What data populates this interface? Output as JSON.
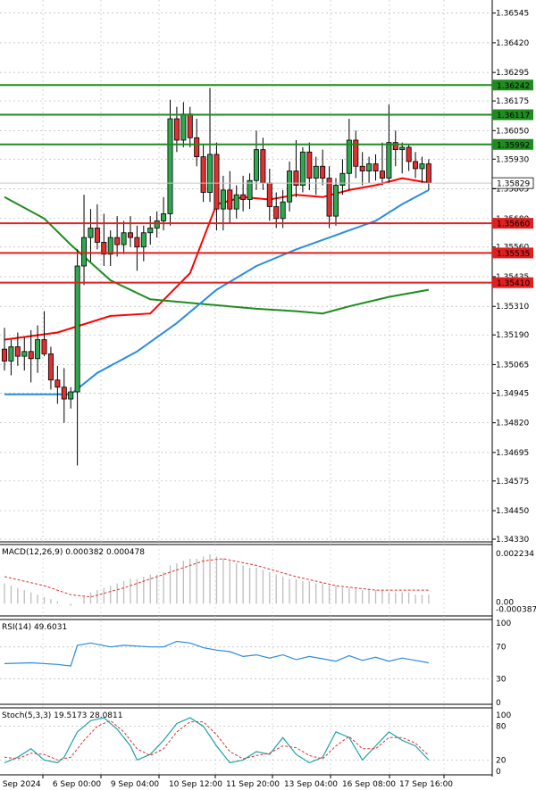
{
  "chart_data": {
    "type": "candlestick",
    "price_axis": {
      "ticks": [
        "1.36545",
        "1.36420",
        "1.36295",
        "1.36175",
        "1.36050",
        "1.35930",
        "1.35805",
        "1.35680",
        "1.35560",
        "1.35435",
        "1.35310",
        "1.35190",
        "1.35065",
        "1.34945",
        "1.34820",
        "1.34695",
        "1.34575",
        "1.34450",
        "1.34330"
      ],
      "range": [
        1.3433,
        1.366
      ]
    },
    "time_axis": {
      "labels": [
        "5 Sep 2024",
        "6 Sep 00:00",
        "9 Sep 04:00",
        "10 Sep 12:00",
        "11 Sep 20:00",
        "13 Sep 04:00",
        "16 Sep 08:00",
        "17 Sep 16:00"
      ]
    },
    "levels": [
      {
        "value": "1.36242",
        "color": "#1e8c1e"
      },
      {
        "value": "1.36117",
        "color": "#1e8c1e"
      },
      {
        "value": "1.35992",
        "color": "#1e8c1e"
      },
      {
        "value": "1.35660",
        "color": "#e02020"
      },
      {
        "value": "1.35535",
        "color": "#e02020"
      },
      {
        "value": "1.35410",
        "color": "#e02020"
      }
    ],
    "current_price": {
      "value": "1.35829",
      "color": "#c8c8c8"
    },
    "candles": [
      {
        "o": 1.3513,
        "h": 1.3522,
        "l": 1.3504,
        "c": 1.3508
      },
      {
        "o": 1.3508,
        "h": 1.3517,
        "l": 1.3502,
        "c": 1.3514
      },
      {
        "o": 1.3514,
        "h": 1.352,
        "l": 1.3506,
        "c": 1.351
      },
      {
        "o": 1.351,
        "h": 1.3518,
        "l": 1.3504,
        "c": 1.3512
      },
      {
        "o": 1.3512,
        "h": 1.3521,
        "l": 1.3499,
        "c": 1.3509
      },
      {
        "o": 1.3509,
        "h": 1.3523,
        "l": 1.3503,
        "c": 1.3517
      },
      {
        "o": 1.3517,
        "h": 1.3529,
        "l": 1.351,
        "c": 1.3511
      },
      {
        "o": 1.3511,
        "h": 1.3514,
        "l": 1.3496,
        "c": 1.35
      },
      {
        "o": 1.35,
        "h": 1.3506,
        "l": 1.349,
        "c": 1.3497
      },
      {
        "o": 1.3497,
        "h": 1.3505,
        "l": 1.3482,
        "c": 1.3492
      },
      {
        "o": 1.3492,
        "h": 1.3497,
        "l": 1.3488,
        "c": 1.3495
      },
      {
        "o": 1.3495,
        "h": 1.3555,
        "l": 1.3464,
        "c": 1.3548
      },
      {
        "o": 1.3548,
        "h": 1.3578,
        "l": 1.354,
        "c": 1.356
      },
      {
        "o": 1.356,
        "h": 1.3572,
        "l": 1.355,
        "c": 1.3564
      },
      {
        "o": 1.3564,
        "h": 1.3574,
        "l": 1.3555,
        "c": 1.3558
      },
      {
        "o": 1.3558,
        "h": 1.357,
        "l": 1.3548,
        "c": 1.3553
      },
      {
        "o": 1.3553,
        "h": 1.3563,
        "l": 1.3548,
        "c": 1.356
      },
      {
        "o": 1.356,
        "h": 1.3569,
        "l": 1.3552,
        "c": 1.3557
      },
      {
        "o": 1.3557,
        "h": 1.3567,
        "l": 1.3553,
        "c": 1.3562
      },
      {
        "o": 1.3562,
        "h": 1.3569,
        "l": 1.3556,
        "c": 1.356
      },
      {
        "o": 1.356,
        "h": 1.3565,
        "l": 1.3546,
        "c": 1.3556
      },
      {
        "o": 1.3556,
        "h": 1.3565,
        "l": 1.355,
        "c": 1.3562
      },
      {
        "o": 1.3562,
        "h": 1.3569,
        "l": 1.3557,
        "c": 1.3564
      },
      {
        "o": 1.3564,
        "h": 1.3571,
        "l": 1.356,
        "c": 1.3567
      },
      {
        "o": 1.3567,
        "h": 1.3577,
        "l": 1.3563,
        "c": 1.357
      },
      {
        "o": 1.357,
        "h": 1.3618,
        "l": 1.3565,
        "c": 1.361
      },
      {
        "o": 1.361,
        "h": 1.3615,
        "l": 1.3596,
        "c": 1.3601
      },
      {
        "o": 1.3601,
        "h": 1.3617,
        "l": 1.3598,
        "c": 1.3612
      },
      {
        "o": 1.3612,
        "h": 1.3615,
        "l": 1.3598,
        "c": 1.3602
      },
      {
        "o": 1.3602,
        "h": 1.361,
        "l": 1.359,
        "c": 1.3594
      },
      {
        "o": 1.3594,
        "h": 1.3599,
        "l": 1.3575,
        "c": 1.3579
      },
      {
        "o": 1.3579,
        "h": 1.3623,
        "l": 1.3575,
        "c": 1.3595
      },
      {
        "o": 1.3595,
        "h": 1.36,
        "l": 1.3563,
        "c": 1.3572
      },
      {
        "o": 1.3572,
        "h": 1.3586,
        "l": 1.3563,
        "c": 1.358
      },
      {
        "o": 1.358,
        "h": 1.3588,
        "l": 1.3566,
        "c": 1.3572
      },
      {
        "o": 1.3572,
        "h": 1.3582,
        "l": 1.3568,
        "c": 1.3578
      },
      {
        "o": 1.3578,
        "h": 1.3586,
        "l": 1.3571,
        "c": 1.3576
      },
      {
        "o": 1.3576,
        "h": 1.3587,
        "l": 1.3572,
        "c": 1.3584
      },
      {
        "o": 1.3584,
        "h": 1.3605,
        "l": 1.358,
        "c": 1.3597
      },
      {
        "o": 1.3597,
        "h": 1.3602,
        "l": 1.358,
        "c": 1.3583
      },
      {
        "o": 1.3583,
        "h": 1.3589,
        "l": 1.3567,
        "c": 1.3573
      },
      {
        "o": 1.3573,
        "h": 1.3579,
        "l": 1.3564,
        "c": 1.3568
      },
      {
        "o": 1.3568,
        "h": 1.358,
        "l": 1.3564,
        "c": 1.3575
      },
      {
        "o": 1.3575,
        "h": 1.3592,
        "l": 1.3571,
        "c": 1.3588
      },
      {
        "o": 1.3588,
        "h": 1.3601,
        "l": 1.3577,
        "c": 1.3582
      },
      {
        "o": 1.3582,
        "h": 1.3598,
        "l": 1.3579,
        "c": 1.3596
      },
      {
        "o": 1.3596,
        "h": 1.36,
        "l": 1.358,
        "c": 1.3585
      },
      {
        "o": 1.3585,
        "h": 1.3594,
        "l": 1.3578,
        "c": 1.359
      },
      {
        "o": 1.359,
        "h": 1.3597,
        "l": 1.3582,
        "c": 1.3585
      },
      {
        "o": 1.3585,
        "h": 1.359,
        "l": 1.3564,
        "c": 1.3569
      },
      {
        "o": 1.3569,
        "h": 1.3585,
        "l": 1.3565,
        "c": 1.3582
      },
      {
        "o": 1.3582,
        "h": 1.3593,
        "l": 1.3578,
        "c": 1.3587
      },
      {
        "o": 1.3587,
        "h": 1.361,
        "l": 1.358,
        "c": 1.3601
      },
      {
        "o": 1.3601,
        "h": 1.3605,
        "l": 1.3585,
        "c": 1.359
      },
      {
        "o": 1.359,
        "h": 1.3596,
        "l": 1.3582,
        "c": 1.3588
      },
      {
        "o": 1.3588,
        "h": 1.3594,
        "l": 1.3583,
        "c": 1.3591
      },
      {
        "o": 1.3591,
        "h": 1.3595,
        "l": 1.3584,
        "c": 1.3588
      },
      {
        "o": 1.3588,
        "h": 1.36,
        "l": 1.3582,
        "c": 1.3585
      },
      {
        "o": 1.3585,
        "h": 1.3616,
        "l": 1.3583,
        "c": 1.36
      },
      {
        "o": 1.36,
        "h": 1.3605,
        "l": 1.359,
        "c": 1.3597
      },
      {
        "o": 1.3597,
        "h": 1.36,
        "l": 1.3587,
        "c": 1.3598
      },
      {
        "o": 1.3598,
        "h": 1.3599,
        "l": 1.3588,
        "c": 1.3592
      },
      {
        "o": 1.3592,
        "h": 1.3596,
        "l": 1.3585,
        "c": 1.3589
      },
      {
        "o": 1.3589,
        "h": 1.3594,
        "l": 1.3583,
        "c": 1.3591
      },
      {
        "o": 1.3591,
        "h": 1.3593,
        "l": 1.358,
        "c": 1.3583
      }
    ],
    "moving_averages": [
      {
        "color": "#ff0000",
        "points": [
          [
            0,
            1.3517
          ],
          [
            8,
            1.352
          ],
          [
            16,
            1.3527
          ],
          [
            22,
            1.3528
          ],
          [
            28,
            1.3545
          ],
          [
            32,
            1.3574
          ],
          [
            36,
            1.3577
          ],
          [
            40,
            1.3576
          ],
          [
            44,
            1.3578
          ],
          [
            48,
            1.3577
          ],
          [
            52,
            1.358
          ],
          [
            56,
            1.3582
          ],
          [
            60,
            1.3585
          ],
          [
            64,
            1.3583
          ]
        ]
      },
      {
        "color": "#1e8c1e",
        "points": [
          [
            0,
            1.3577
          ],
          [
            6,
            1.3568
          ],
          [
            10,
            1.3557
          ],
          [
            16,
            1.3542
          ],
          [
            22,
            1.3534
          ],
          [
            30,
            1.3532
          ],
          [
            38,
            1.353
          ],
          [
            44,
            1.3529
          ],
          [
            48,
            1.3528
          ],
          [
            52,
            1.3531
          ],
          [
            58,
            1.3535
          ],
          [
            64,
            1.3538
          ]
        ]
      },
      {
        "color": "#2a8ce0",
        "points": [
          [
            0,
            1.3494
          ],
          [
            10,
            1.3494
          ],
          [
            14,
            1.3503
          ],
          [
            20,
            1.3512
          ],
          [
            26,
            1.3524
          ],
          [
            32,
            1.3538
          ],
          [
            38,
            1.3548
          ],
          [
            44,
            1.3555
          ],
          [
            50,
            1.3561
          ],
          [
            56,
            1.3567
          ],
          [
            60,
            1.3574
          ],
          [
            64,
            1.358
          ]
        ]
      }
    ],
    "macd": {
      "label": "MACD(12,26,9) 0.000382 0.000478",
      "ticks": [
        "0.002234",
        "0.00",
        "-0.000387"
      ],
      "range": [
        -0.000387,
        0.002234
      ],
      "histogram": [
        0.0009,
        0.0008,
        0.0007,
        0.0006,
        0.0005,
        0.0004,
        0.0003,
        0.0002,
        0.0001,
        0.0,
        -0.0001,
        0.0,
        0.0003,
        0.0005,
        0.0006,
        0.0007,
        0.0008,
        0.0009,
        0.001,
        0.0011,
        0.0011,
        0.0012,
        0.0013,
        0.0013,
        0.0014,
        0.0017,
        0.0018,
        0.0019,
        0.002,
        0.002,
        0.0021,
        0.0022,
        0.0021,
        0.002,
        0.0019,
        0.0018,
        0.0017,
        0.0016,
        0.0016,
        0.0015,
        0.0014,
        0.0013,
        0.0012,
        0.0011,
        0.0011,
        0.001,
        0.001,
        0.0009,
        0.0009,
        0.0008,
        0.0008,
        0.0007,
        0.0007,
        0.0007,
        0.0006,
        0.0006,
        0.0006,
        0.0006,
        0.0005,
        0.0005,
        0.0005,
        0.0005,
        0.0004,
        0.0004,
        0.0004
      ],
      "signal": [
        [
          0,
          0.0012
        ],
        [
          6,
          0.0008
        ],
        [
          10,
          0.0004
        ],
        [
          13,
          0.0003
        ],
        [
          18,
          0.0007
        ],
        [
          24,
          0.0013
        ],
        [
          30,
          0.0019
        ],
        [
          33,
          0.002
        ],
        [
          38,
          0.0017
        ],
        [
          44,
          0.0012
        ],
        [
          50,
          0.0008
        ],
        [
          56,
          0.0006
        ],
        [
          60,
          0.0006
        ],
        [
          64,
          0.0006
        ]
      ]
    },
    "rsi": {
      "label": "RSI(14) 49.6031",
      "ticks": [
        "100",
        "70",
        "30",
        "0"
      ],
      "values": [
        [
          0,
          49
        ],
        [
          4,
          50
        ],
        [
          8,
          48
        ],
        [
          10,
          46
        ],
        [
          11,
          72
        ],
        [
          13,
          75
        ],
        [
          16,
          70
        ],
        [
          18,
          72
        ],
        [
          22,
          70
        ],
        [
          24,
          70
        ],
        [
          26,
          77
        ],
        [
          28,
          75
        ],
        [
          30,
          69
        ],
        [
          32,
          66
        ],
        [
          34,
          64
        ],
        [
          36,
          58
        ],
        [
          38,
          60
        ],
        [
          40,
          56
        ],
        [
          42,
          60
        ],
        [
          44,
          54
        ],
        [
          46,
          58
        ],
        [
          48,
          55
        ],
        [
          50,
          52
        ],
        [
          52,
          59
        ],
        [
          54,
          53
        ],
        [
          56,
          57
        ],
        [
          58,
          52
        ],
        [
          60,
          56
        ],
        [
          62,
          53
        ],
        [
          64,
          50
        ]
      ]
    },
    "stoch": {
      "label": "Stoch(5,3,3) 19.5173 28.0811",
      "ticks": [
        "100",
        "80",
        "20",
        "0"
      ],
      "k": [
        [
          0,
          15
        ],
        [
          2,
          25
        ],
        [
          4,
          40
        ],
        [
          6,
          20
        ],
        [
          8,
          15
        ],
        [
          9,
          25
        ],
        [
          11,
          70
        ],
        [
          13,
          90
        ],
        [
          15,
          95
        ],
        [
          17,
          75
        ],
        [
          19,
          45
        ],
        [
          20,
          20
        ],
        [
          22,
          30
        ],
        [
          24,
          55
        ],
        [
          26,
          85
        ],
        [
          28,
          95
        ],
        [
          30,
          80
        ],
        [
          32,
          45
        ],
        [
          34,
          15
        ],
        [
          36,
          20
        ],
        [
          38,
          35
        ],
        [
          40,
          30
        ],
        [
          42,
          60
        ],
        [
          44,
          30
        ],
        [
          46,
          15
        ],
        [
          48,
          25
        ],
        [
          50,
          70
        ],
        [
          52,
          60
        ],
        [
          54,
          20
        ],
        [
          56,
          45
        ],
        [
          58,
          70
        ],
        [
          60,
          55
        ],
        [
          62,
          45
        ],
        [
          64,
          20
        ]
      ],
      "d": [
        [
          0,
          25
        ],
        [
          2,
          22
        ],
        [
          4,
          32
        ],
        [
          6,
          30
        ],
        [
          8,
          20
        ],
        [
          10,
          25
        ],
        [
          12,
          55
        ],
        [
          14,
          80
        ],
        [
          16,
          90
        ],
        [
          18,
          70
        ],
        [
          20,
          40
        ],
        [
          22,
          28
        ],
        [
          24,
          40
        ],
        [
          26,
          70
        ],
        [
          28,
          88
        ],
        [
          30,
          88
        ],
        [
          32,
          65
        ],
        [
          34,
          35
        ],
        [
          36,
          22
        ],
        [
          38,
          28
        ],
        [
          40,
          32
        ],
        [
          42,
          45
        ],
        [
          44,
          42
        ],
        [
          46,
          28
        ],
        [
          48,
          22
        ],
        [
          50,
          45
        ],
        [
          52,
          62
        ],
        [
          54,
          40
        ],
        [
          56,
          40
        ],
        [
          58,
          60
        ],
        [
          60,
          60
        ],
        [
          62,
          50
        ],
        [
          64,
          28
        ]
      ]
    }
  }
}
